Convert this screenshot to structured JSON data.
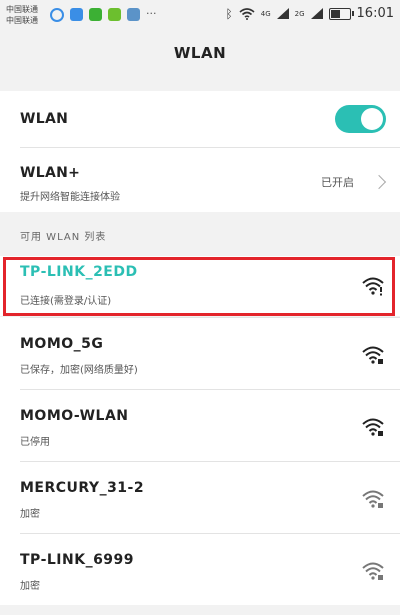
{
  "status_bar": {
    "carrier_1": "中国联通",
    "carrier_2": "中国联通",
    "sig_tag_1": "4G",
    "sig_tag_2": "2G",
    "battery_level": 0.55,
    "time": "16:01"
  },
  "header": {
    "title": "WLAN"
  },
  "wlan": {
    "label": "WLAN",
    "enabled": true,
    "accent_color": "#2bbfb4"
  },
  "wlan_plus": {
    "label": "WLAN+",
    "subtitle": "提升网络智能连接体验",
    "state": "已开启"
  },
  "available_section": {
    "label": "可用 WLAN 列表"
  },
  "networks": [
    {
      "name": "TP-LINK_2EDD",
      "status": "已连接(需登录/认证)",
      "connected": true,
      "name_color": "#2bbfb4"
    },
    {
      "name": "MOMO_5G",
      "status": "已保存，加密(网络质量好)"
    },
    {
      "name": "MOMO-WLAN",
      "status": "已停用"
    },
    {
      "name": "MERCURY_31-2",
      "status": "加密"
    },
    {
      "name": "TP-LINK_6999",
      "status": "加密"
    }
  ]
}
